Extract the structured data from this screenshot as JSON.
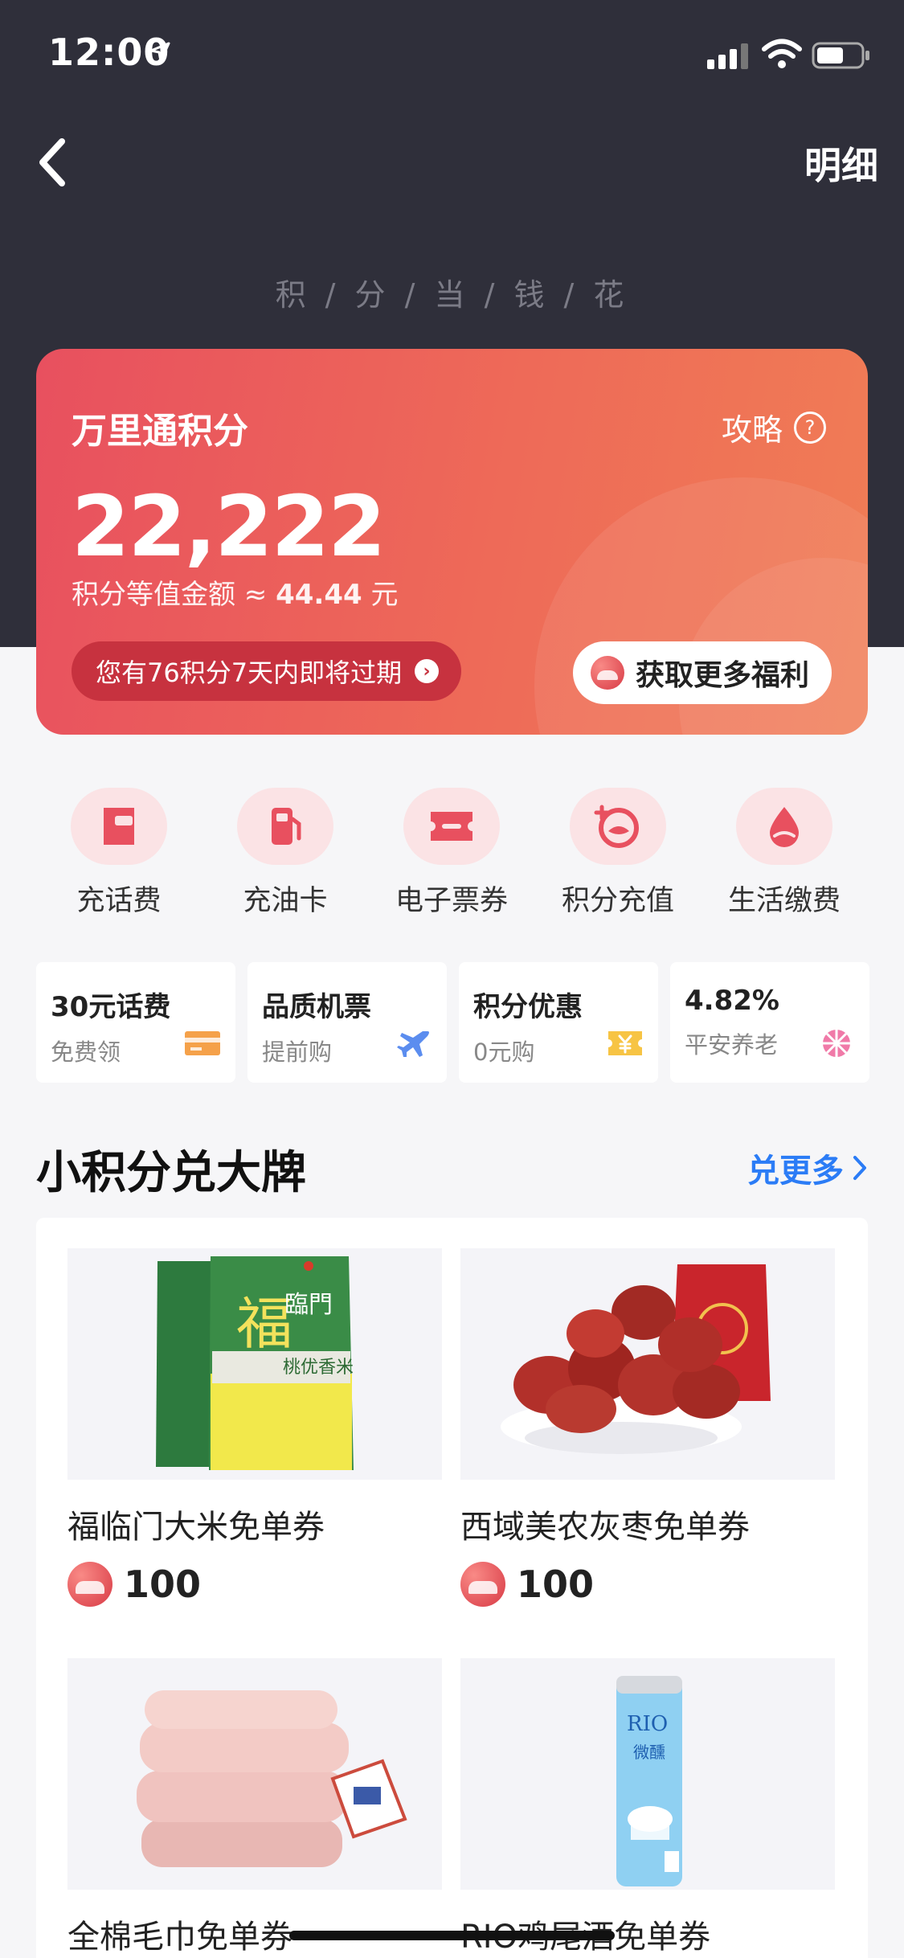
{
  "status_bar": {
    "time": "12:00"
  },
  "nav": {
    "detail_label": "明细"
  },
  "slogan": "积 / 分 / 当 / 钱 / 花",
  "points_card": {
    "title": "万里通积分",
    "guide_label": "攻略",
    "guide_icon": "?",
    "points": "22,222",
    "equiv_prefix": "积分等值金额 ≈ ",
    "equiv_amount": "44.44",
    "equiv_unit": " 元",
    "expire_notice": "您有76积分7天内即将过期",
    "more_benefit_label": "获取更多福利"
  },
  "services": [
    {
      "label": "充话费",
      "icon": "phone-recharge-icon"
    },
    {
      "label": "充油卡",
      "icon": "fuel-pump-icon"
    },
    {
      "label": "电子票券",
      "icon": "ticket-icon"
    },
    {
      "label": "积分充值",
      "icon": "points-recharge-icon"
    },
    {
      "label": "生活缴费",
      "icon": "water-drop-icon"
    }
  ],
  "promos": [
    {
      "title": "30元话费",
      "sub": "免费领",
      "icon": "card-icon",
      "color": "#f5a14a"
    },
    {
      "title": "品质机票",
      "sub": "提前购",
      "icon": "airplane-icon",
      "color": "#5b8def"
    },
    {
      "title": "积分优惠",
      "sub": "0元购",
      "icon": "yuan-ticket-icon",
      "color": "#f7c444"
    },
    {
      "title": "4.82%",
      "sub": "平安养老",
      "icon": "pinwheel-icon",
      "color": "#f07aa8"
    }
  ],
  "section": {
    "title": "小积分兑大牌",
    "more_label": "兑更多"
  },
  "products": [
    {
      "name": "福临门大米免单券",
      "price": "100",
      "image": "rice-bag-image"
    },
    {
      "name": "西域美农灰枣免单券",
      "price": "100",
      "image": "red-dates-image"
    },
    {
      "name": "全棉毛巾免单券",
      "price": "",
      "image": "towels-image"
    },
    {
      "name": "RIO鸡尾酒免单券",
      "price": "",
      "image": "rio-can-image"
    }
  ],
  "colors": {
    "header_bg": "#2f2f3a",
    "card_gradient_start": "#e8505f",
    "card_gradient_end": "#f07d55",
    "accent_blue": "#2b7cf6",
    "icon_bg": "#fbe3e5",
    "icon_red": "#e8505f"
  }
}
